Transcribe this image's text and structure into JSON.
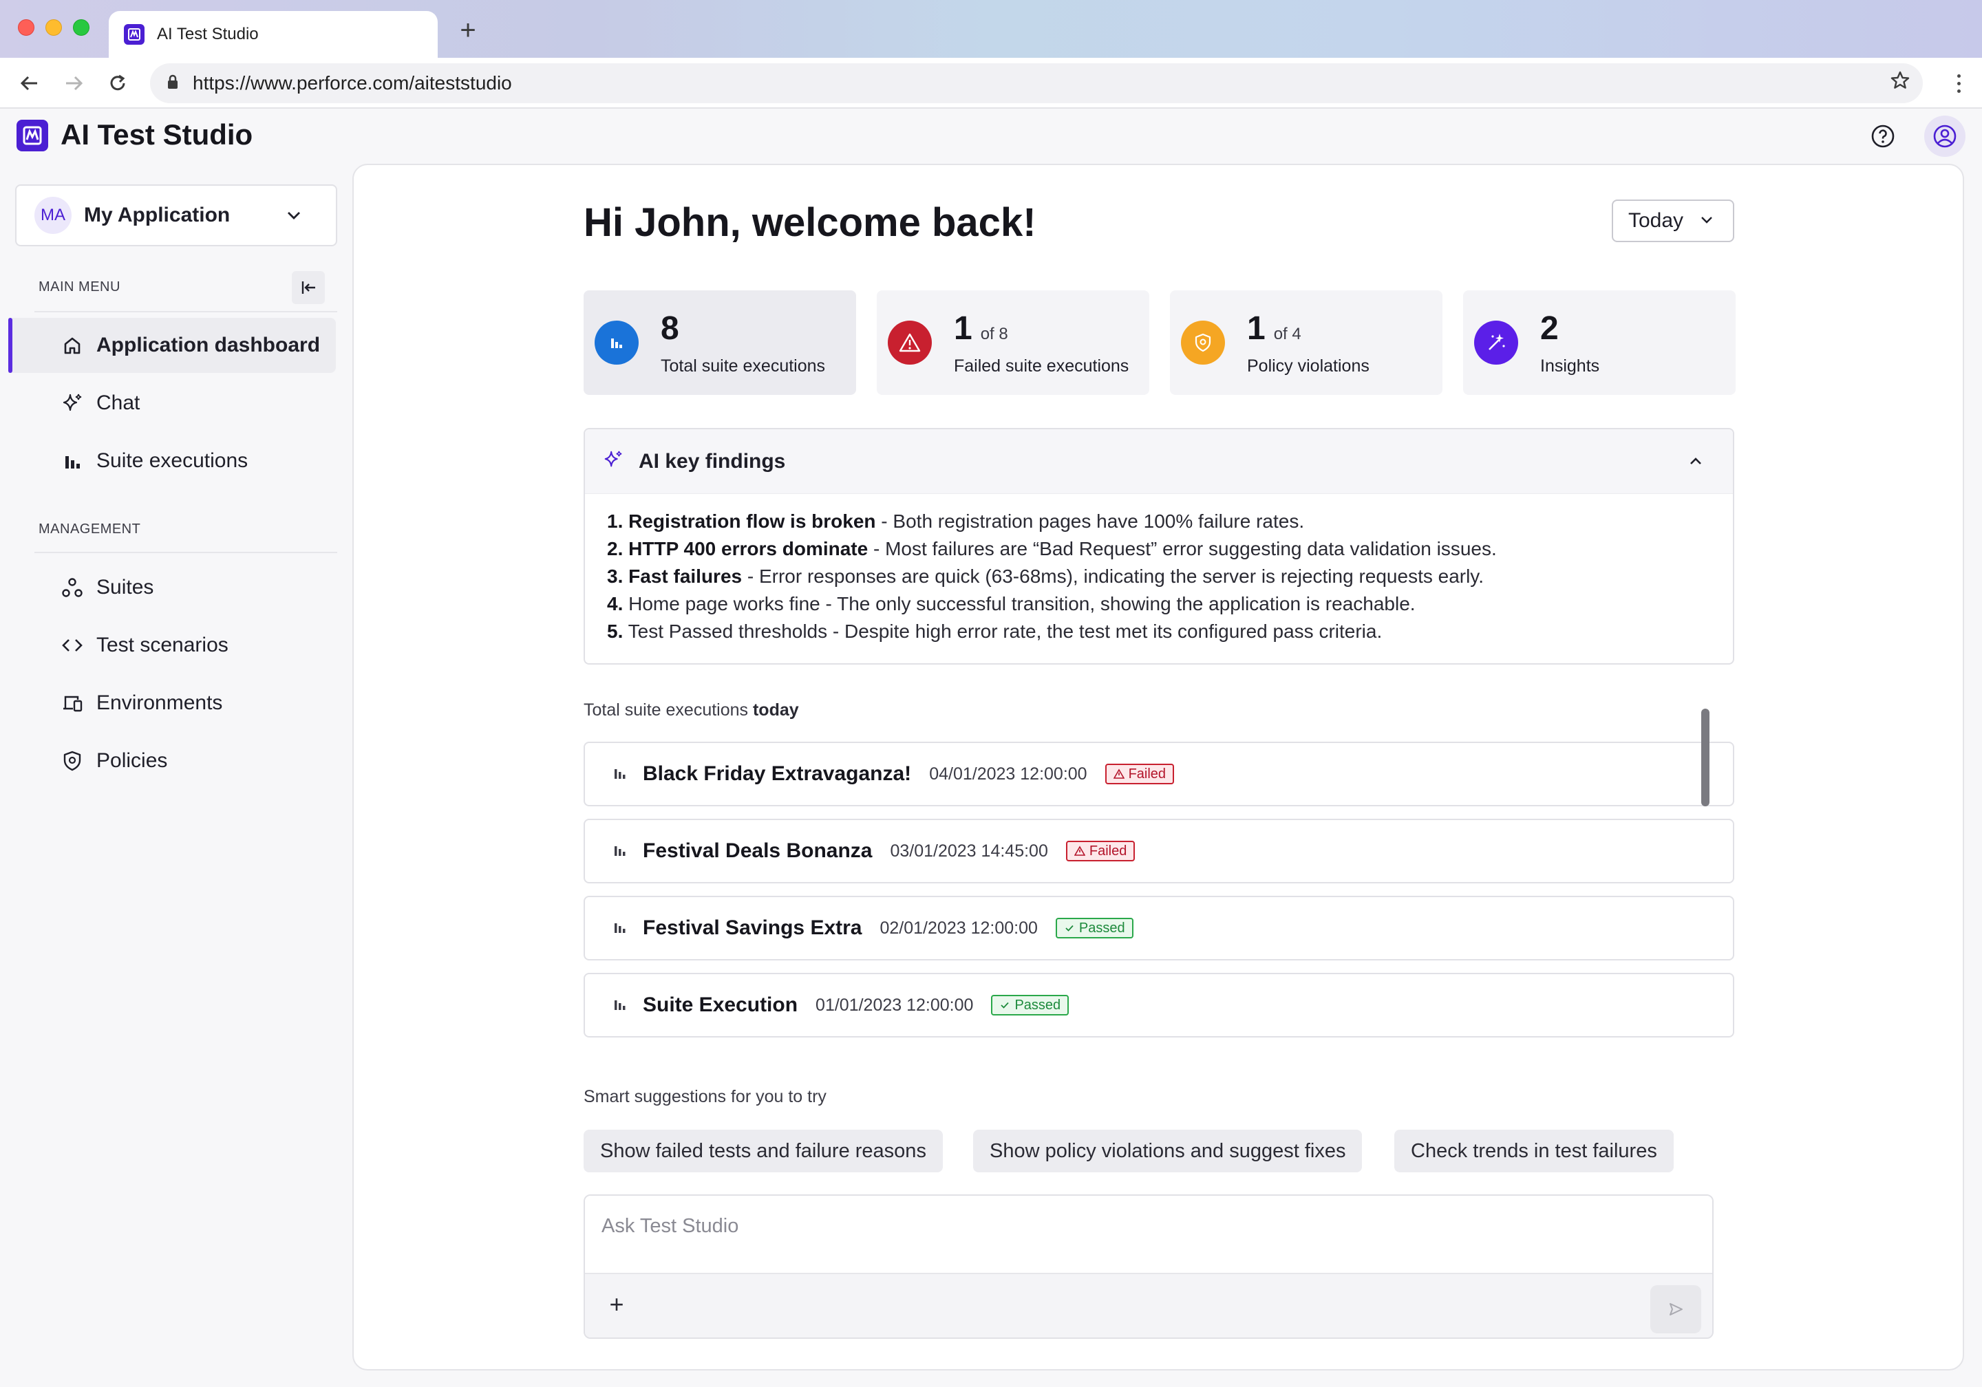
{
  "browser": {
    "tab_title": "AI Test Studio",
    "url": "https://www.perforce.com/aiteststudio"
  },
  "app": {
    "title": "AI Test Studio",
    "accent_color": "#4b1fd3"
  },
  "sidebar": {
    "app_initials": "MA",
    "app_name": "My Application",
    "main_menu_label": "MAIN MENU",
    "main_items": [
      {
        "label": "Application dashboard",
        "icon": "home-icon",
        "active": true
      },
      {
        "label": "Chat",
        "icon": "sparkle-icon",
        "active": false
      },
      {
        "label": "Suite executions",
        "icon": "bar-chart-icon",
        "active": false
      }
    ],
    "management_label": "MANAGEMENT",
    "management_items": [
      {
        "label": "Suites",
        "icon": "nodes-icon"
      },
      {
        "label": "Test scenarios",
        "icon": "code-icon"
      },
      {
        "label": "Environments",
        "icon": "devices-icon"
      },
      {
        "label": "Policies",
        "icon": "shield-icon"
      }
    ]
  },
  "main": {
    "greeting": "Hi John, welcome back!",
    "period": "Today",
    "stats": [
      {
        "value": "8",
        "of": "",
        "label": "Total suite executions",
        "color": "#1a73d9",
        "icon": "bar-chart-icon"
      },
      {
        "value": "1",
        "of": "of 8",
        "label": "Failed suite executions",
        "color": "#c8202f",
        "icon": "warning-icon"
      },
      {
        "value": "1",
        "of": "of 4",
        "label": "Policy violations",
        "color": "#f5a623",
        "icon": "shield-icon"
      },
      {
        "value": "2",
        "of": "",
        "label": "Insights",
        "color": "#5b1fe8",
        "icon": "magic-wand-icon"
      }
    ],
    "findings": {
      "title": "AI key findings",
      "items": [
        {
          "num": "1.",
          "bold": "Registration flow is broken",
          "text": " - Both registration pages have 100% failure rates."
        },
        {
          "num": "2.",
          "bold": "HTTP 400 errors dominate",
          "text": " - Most failures are “Bad Request” error suggesting data validation issues."
        },
        {
          "num": "3.",
          "bold": "Fast failures",
          "text": " - Error responses are quick (63-68ms), indicating the server is rejecting requests early."
        },
        {
          "num": "4.",
          "bold": "",
          "text": "Home page works fine - The only successful transition, showing the application is reachable."
        },
        {
          "num": "5.",
          "bold": "",
          "text": "Test Passed thresholds - Despite high error rate, the test met its configured pass criteria."
        }
      ]
    },
    "executions_heading": "Total suite executions",
    "executions_heading_bold": "today",
    "executions": [
      {
        "name": "Black Friday Extravaganza!",
        "date": "04/01/2023 12:00:00",
        "status": "Failed"
      },
      {
        "name": "Festival Deals Bonanza",
        "date": "03/01/2023 14:45:00",
        "status": "Failed"
      },
      {
        "name": "Festival Savings Extra",
        "date": "02/01/2023 12:00:00",
        "status": "Passed"
      },
      {
        "name": "Suite Execution",
        "date": "01/01/2023 12:00:00",
        "status": "Passed"
      }
    ],
    "suggestions_heading": "Smart suggestions for you to try",
    "suggestions": [
      "Show failed tests and failure reasons",
      "Show policy violations and suggest fixes",
      "Check trends in test failures"
    ],
    "composer_placeholder": "Ask Test Studio"
  }
}
